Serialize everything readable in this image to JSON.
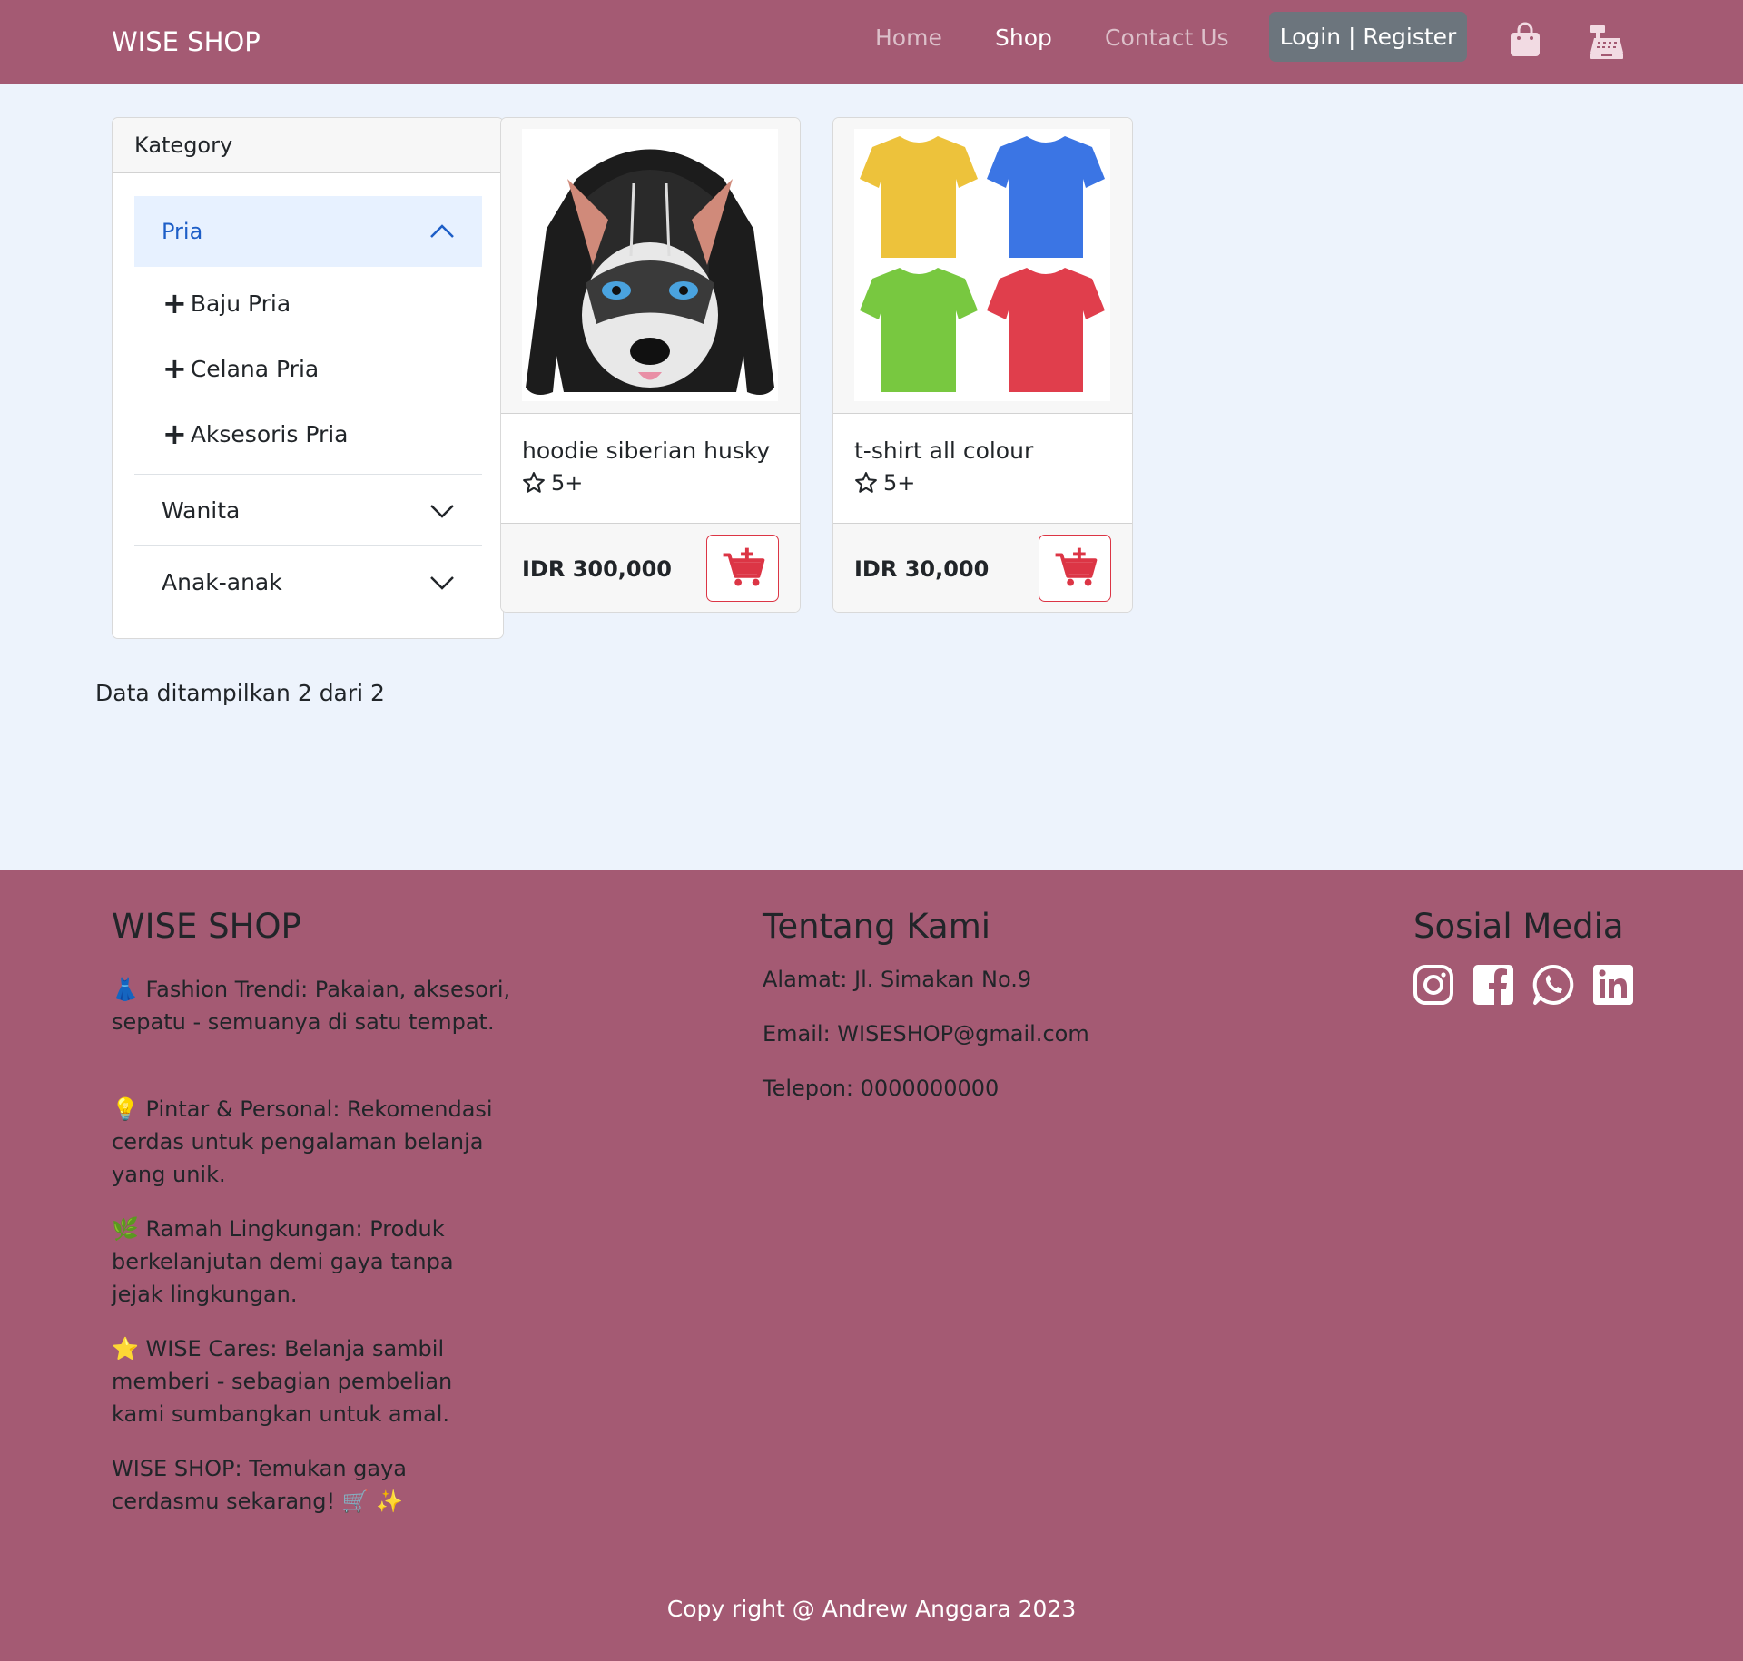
{
  "navbar": {
    "brand": "WISE SHOP",
    "links": [
      "Home",
      "Shop",
      "Contact Us"
    ],
    "login_label": "Login | Register",
    "bag_icon": "shopping-bag-icon",
    "register_icon": "cash-register-icon",
    "bg_color": "#a45a73"
  },
  "sidebar": {
    "header": "Kategory",
    "open_section": {
      "label": "Pria",
      "items": [
        "Baju Pria",
        "Celana Pria",
        "Aksesoris Pria"
      ]
    },
    "closed_sections": [
      "Wanita",
      "Anak-anak"
    ],
    "accent": "#1d5ec7"
  },
  "products": [
    {
      "title": "hoodie siberian husky",
      "rating": "5+",
      "price": "IDR 300,000"
    },
    {
      "title": "t-shirt all colour",
      "rating": "5+",
      "price": "IDR 30,000"
    }
  ],
  "list_info": "Data ditampilkan 2 dari 2",
  "footer": {
    "col1": {
      "title": "WISE SHOP",
      "paragraphs": [
        "👗 Fashion Trendi: Pakaian, aksesori, sepatu - semuanya di satu tempat.",
        "💡 Pintar & Personal: Rekomendasi cerdas untuk pengalaman belanja yang unik.",
        "🌿 Ramah Lingkungan: Produk berkelanjutan demi gaya tanpa jejak lingkungan.",
        "⭐ WISE Cares: Belanja sambil memberi - sebagian pembelian kami sumbangkan untuk amal.",
        "WISE SHOP: Temukan gaya cerdasmu sekarang! 🛒 ✨"
      ]
    },
    "col2": {
      "title": "Tentang Kami",
      "lines": [
        "Alamat: Jl. Simakan No.9",
        "Email: WISESHOP@gmail.com",
        "Telepon: 0000000000"
      ]
    },
    "col3": {
      "title": "Sosial Media",
      "icons": [
        "instagram-icon",
        "facebook-icon",
        "whatsapp-icon",
        "linkedin-icon"
      ]
    },
    "copyright": "Copy right @ Andrew Anggara 2023"
  },
  "colors": {
    "page_bg": "#edf3fc",
    "brand": "#a45a73",
    "danger": "#dc3545",
    "secondary": "#6c757d"
  }
}
